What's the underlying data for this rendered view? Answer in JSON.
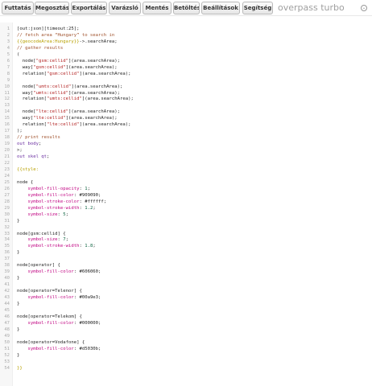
{
  "toolbar": {
    "buttons": [
      {
        "label": "Futtatás",
        "name": "run-button"
      },
      {
        "label": "Megosztás",
        "name": "share-button"
      },
      {
        "label": "Exportálás",
        "name": "export-button"
      },
      {
        "label": "Varázsló",
        "name": "wizard-button"
      },
      {
        "label": "Mentés",
        "name": "save-button"
      },
      {
        "label": "Betöltés",
        "name": "load-button"
      },
      {
        "label": "Beállítások",
        "name": "settings-button"
      },
      {
        "label": "Segítség",
        "name": "help-button"
      }
    ],
    "brand": "overpass turbo",
    "brand_icon": "chevron-down-circle-icon"
  },
  "editor": {
    "lines": [
      [
        [
          "t-plain",
          "[out:json][timeout:25];"
        ]
      ],
      [
        [
          "t-cm",
          "// fetch area “Hungary” to search in"
        ]
      ],
      [
        [
          "t-tpl",
          "{{geocodeArea:Hungary}}"
        ],
        [
          "t-plain",
          "->.searchArea;"
        ]
      ],
      [
        [
          "t-cm",
          "// gather results"
        ]
      ],
      [
        [
          "t-plain",
          "("
        ]
      ],
      [
        [
          "t-plain",
          "  node["
        ],
        [
          "t-str",
          "\"gsm:cellid\""
        ],
        [
          "t-plain",
          "](area.searchArea);"
        ]
      ],
      [
        [
          "t-plain",
          "  way["
        ],
        [
          "t-str",
          "\"gsm:cellid\""
        ],
        [
          "t-plain",
          "](area.searchArea);"
        ]
      ],
      [
        [
          "t-plain",
          "  relation["
        ],
        [
          "t-str",
          "\"gsm:cellid\""
        ],
        [
          "t-plain",
          "](area.searchArea);"
        ]
      ],
      [],
      [
        [
          "t-plain",
          "  node["
        ],
        [
          "t-str",
          "\"umts:cellid\""
        ],
        [
          "t-plain",
          "](area.searchArea);"
        ]
      ],
      [
        [
          "t-plain",
          "  way["
        ],
        [
          "t-str",
          "\"umts:cellid\""
        ],
        [
          "t-plain",
          "](area.searchArea);"
        ]
      ],
      [
        [
          "t-plain",
          "  relation["
        ],
        [
          "t-str",
          "\"umts:cellid\""
        ],
        [
          "t-plain",
          "](area.searchArea);"
        ]
      ],
      [],
      [
        [
          "t-plain",
          "  node["
        ],
        [
          "t-str",
          "\"lte:cellid\""
        ],
        [
          "t-plain",
          "](area.searchArea);"
        ]
      ],
      [
        [
          "t-plain",
          "  way["
        ],
        [
          "t-str",
          "\"lte:cellid\""
        ],
        [
          "t-plain",
          "](area.searchArea);"
        ]
      ],
      [
        [
          "t-plain",
          "  relation["
        ],
        [
          "t-str",
          "\"lte:cellid\""
        ],
        [
          "t-plain",
          "](area.searchArea);"
        ]
      ],
      [
        [
          "t-plain",
          ");"
        ]
      ],
      [
        [
          "t-cm",
          "// print results"
        ]
      ],
      [
        [
          "t-kw",
          "out body"
        ],
        [
          "t-plain",
          ";"
        ]
      ],
      [
        [
          "t-plain",
          ">;"
        ]
      ],
      [
        [
          "t-kw",
          "out skel qt"
        ],
        [
          "t-plain",
          ";"
        ]
      ],
      [],
      [
        [
          "t-tpl",
          "{{style:"
        ]
      ],
      [],
      [
        [
          "t-sel",
          "node {"
        ]
      ],
      [
        [
          "t-prop",
          "    symbol-fill-opacity"
        ],
        [
          "t-plain",
          ": "
        ],
        [
          "t-num",
          "1"
        ],
        [
          "t-plain",
          ";"
        ]
      ],
      [
        [
          "t-prop",
          "    symbol-fill-color"
        ],
        [
          "t-plain",
          ": #909090;"
        ]
      ],
      [
        [
          "t-prop",
          "    symbol-stroke-color"
        ],
        [
          "t-plain",
          ": #ffffff;"
        ]
      ],
      [
        [
          "t-prop",
          "    symbol-stroke-width"
        ],
        [
          "t-plain",
          ": "
        ],
        [
          "t-num",
          "1.2"
        ],
        [
          "t-plain",
          ";"
        ]
      ],
      [
        [
          "t-prop",
          "    symbol-size"
        ],
        [
          "t-plain",
          ": "
        ],
        [
          "t-num",
          "5"
        ],
        [
          "t-plain",
          ";"
        ]
      ],
      [
        [
          "t-plain",
          "}"
        ]
      ],
      [],
      [
        [
          "t-sel",
          "node[gsm:cellid] {"
        ]
      ],
      [
        [
          "t-prop",
          "    symbol-size"
        ],
        [
          "t-plain",
          ": "
        ],
        [
          "t-num",
          "7"
        ],
        [
          "t-plain",
          ";"
        ]
      ],
      [
        [
          "t-prop",
          "    symbol-stroke-width"
        ],
        [
          "t-plain",
          ": "
        ],
        [
          "t-num",
          "1.8"
        ],
        [
          "t-plain",
          ";"
        ]
      ],
      [
        [
          "t-plain",
          "}"
        ]
      ],
      [],
      [
        [
          "t-sel",
          "node[operator] {"
        ]
      ],
      [
        [
          "t-prop",
          "    symbol-fill-color"
        ],
        [
          "t-plain",
          ": #606060;"
        ]
      ],
      [
        [
          "t-plain",
          "}"
        ]
      ],
      [],
      [
        [
          "t-sel",
          "node[operator=Telenor] {"
        ]
      ],
      [
        [
          "t-prop",
          "    symbol-fill-color"
        ],
        [
          "t-plain",
          ": #00a9e3;"
        ]
      ],
      [
        [
          "t-plain",
          "}"
        ]
      ],
      [],
      [
        [
          "t-sel",
          "node[operator=Telekom] {"
        ]
      ],
      [
        [
          "t-prop",
          "    symbol-fill-color"
        ],
        [
          "t-plain",
          ": #000000;"
        ]
      ],
      [
        [
          "t-plain",
          "}"
        ]
      ],
      [],
      [
        [
          "t-sel",
          "node[operator=Vodafone] {"
        ]
      ],
      [
        [
          "t-prop",
          "    symbol-fill-color"
        ],
        [
          "t-plain",
          ": #d5030b;"
        ]
      ],
      [
        [
          "t-plain",
          "}"
        ]
      ],
      [],
      [
        [
          "t-tpl",
          "}}"
        ]
      ]
    ]
  },
  "colors": {
    "comment": "#a0522d",
    "string": "#b22222",
    "template": "#b8a000",
    "property": "#c00080",
    "keyword": "#6b2fa1"
  }
}
